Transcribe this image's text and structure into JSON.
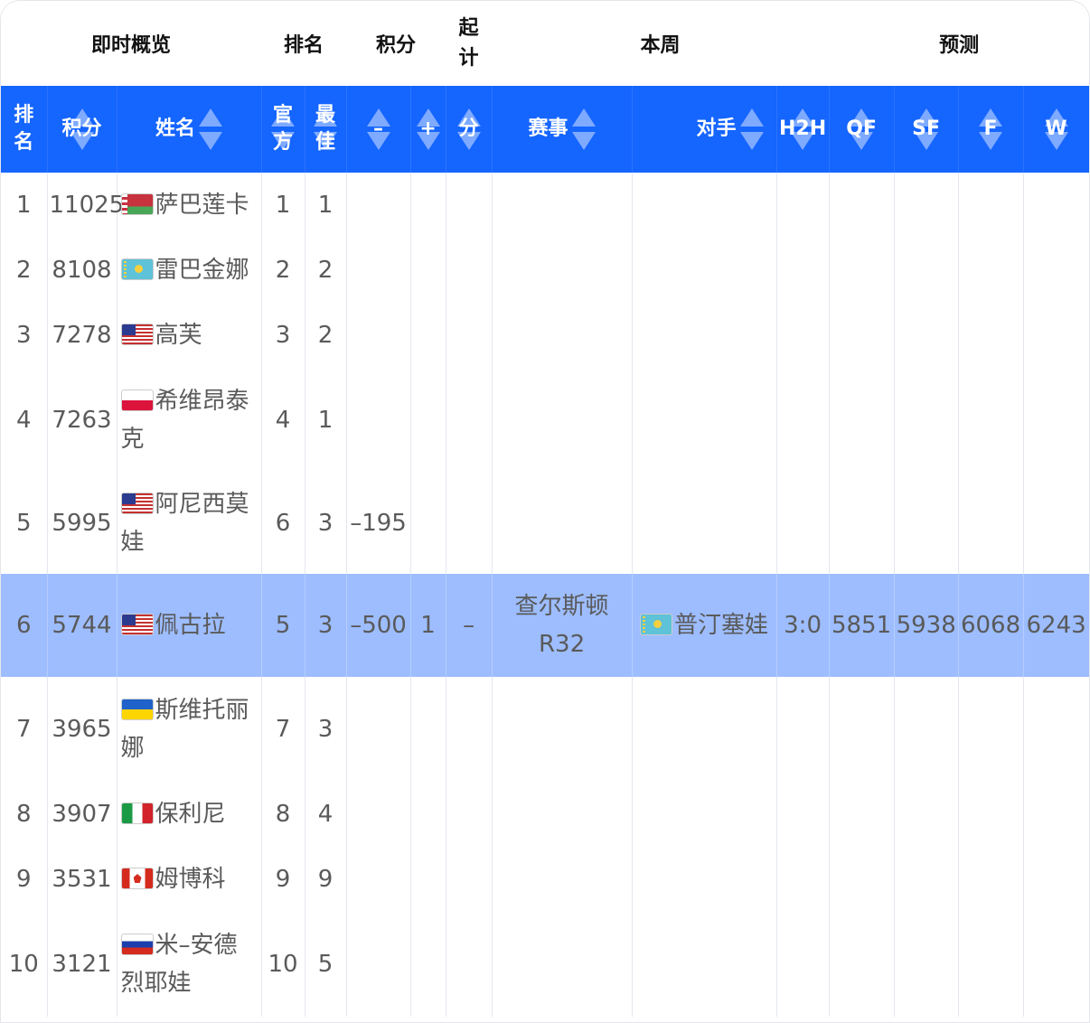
{
  "group_headers": {
    "overview": "即时概览",
    "rank": "排名",
    "points": "积分",
    "start_line1": "起",
    "start_line2": "计",
    "this_week": "本周",
    "forecast": "预测"
  },
  "columns": {
    "rank_l1": "排",
    "rank_l2": "名",
    "points": "积分",
    "name": "姓名",
    "official_l1": "官",
    "official_l2": "方",
    "best_l1": "最",
    "best_l2": "佳",
    "minus": "–",
    "plus": "+",
    "start_points": "分",
    "event": "赛事",
    "opponent": "对手",
    "h2h": "H2H",
    "qf": "QF",
    "sf": "SF",
    "f": "F",
    "w": "W"
  },
  "colors": {
    "header_bg": "#1565ff",
    "highlight_row": "#9dbdff"
  },
  "rows": [
    {
      "rank": "1",
      "points": "11025",
      "flag": "belarus-flag-icon",
      "name": "萨巴莲卡",
      "official": "1",
      "best": "1",
      "minus": "",
      "plus": "",
      "start": "",
      "event": "",
      "opponent_flag": "",
      "opponent": "",
      "h2h": "",
      "qf": "",
      "sf": "",
      "f": "",
      "w": ""
    },
    {
      "rank": "2",
      "points": "8108",
      "flag": "kazakhstan-flag-icon",
      "name": "雷巴金娜",
      "official": "2",
      "best": "2",
      "minus": "",
      "plus": "",
      "start": "",
      "event": "",
      "opponent_flag": "",
      "opponent": "",
      "h2h": "",
      "qf": "",
      "sf": "",
      "f": "",
      "w": ""
    },
    {
      "rank": "3",
      "points": "7278",
      "flag": "usa-flag-icon",
      "name": "高芙",
      "official": "3",
      "best": "2",
      "minus": "",
      "plus": "",
      "start": "",
      "event": "",
      "opponent_flag": "",
      "opponent": "",
      "h2h": "",
      "qf": "",
      "sf": "",
      "f": "",
      "w": ""
    },
    {
      "rank": "4",
      "points": "7263",
      "flag": "poland-flag-icon",
      "name": "希维昂泰克",
      "official": "4",
      "best": "1",
      "minus": "",
      "plus": "",
      "start": "",
      "event": "",
      "opponent_flag": "",
      "opponent": "",
      "h2h": "",
      "qf": "",
      "sf": "",
      "f": "",
      "w": ""
    },
    {
      "rank": "5",
      "points": "5995",
      "flag": "usa-flag-icon",
      "name": "阿尼西莫娃",
      "official": "6",
      "best": "3",
      "minus": "–195",
      "plus": "",
      "start": "",
      "event": "",
      "opponent_flag": "",
      "opponent": "",
      "h2h": "",
      "qf": "",
      "sf": "",
      "f": "",
      "w": ""
    },
    {
      "rank": "6",
      "points": "5744",
      "flag": "usa-flag-icon",
      "name": "佩古拉",
      "official": "5",
      "best": "3",
      "minus": "–500",
      "plus": "1",
      "start": "–",
      "event": "查尔斯顿 R32",
      "opponent_flag": "kazakhstan-flag-icon",
      "opponent": "普汀塞娃",
      "h2h": "3:0",
      "qf": "5851",
      "sf": "5938",
      "f": "6068",
      "w": "6243"
    },
    {
      "rank": "7",
      "points": "3965",
      "flag": "ukraine-flag-icon",
      "name": "斯维托丽娜",
      "official": "7",
      "best": "3",
      "minus": "",
      "plus": "",
      "start": "",
      "event": "",
      "opponent_flag": "",
      "opponent": "",
      "h2h": "",
      "qf": "",
      "sf": "",
      "f": "",
      "w": ""
    },
    {
      "rank": "8",
      "points": "3907",
      "flag": "italy-flag-icon",
      "name": "保利尼",
      "official": "8",
      "best": "4",
      "minus": "",
      "plus": "",
      "start": "",
      "event": "",
      "opponent_flag": "",
      "opponent": "",
      "h2h": "",
      "qf": "",
      "sf": "",
      "f": "",
      "w": ""
    },
    {
      "rank": "9",
      "points": "3531",
      "flag": "canada-flag-icon",
      "name": "姆博科",
      "official": "9",
      "best": "9",
      "minus": "",
      "plus": "",
      "start": "",
      "event": "",
      "opponent_flag": "",
      "opponent": "",
      "h2h": "",
      "qf": "",
      "sf": "",
      "f": "",
      "w": ""
    },
    {
      "rank": "10",
      "points": "3121",
      "flag": "russia-flag-icon",
      "name": "米–安德烈耶娃",
      "official": "10",
      "best": "5",
      "minus": "",
      "plus": "",
      "start": "",
      "event": "",
      "opponent_flag": "",
      "opponent": "",
      "h2h": "",
      "qf": "",
      "sf": "",
      "f": "",
      "w": ""
    }
  ]
}
